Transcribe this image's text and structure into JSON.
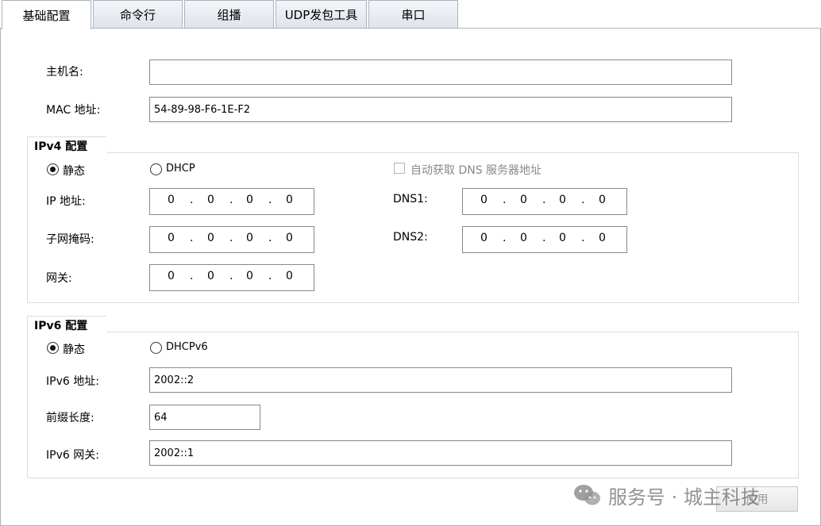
{
  "tabs": [
    {
      "label": "基础配置",
      "active": true
    },
    {
      "label": "命令行",
      "active": false
    },
    {
      "label": "组播",
      "active": false
    },
    {
      "label": "UDP发包工具",
      "active": false
    },
    {
      "label": "串口",
      "active": false
    }
  ],
  "basic": {
    "hostname_label": "主机名:",
    "hostname_value": "",
    "mac_label": "MAC 地址:",
    "mac_value": "54-89-98-F6-1E-F2"
  },
  "ipv4": {
    "legend": "IPv4 配置",
    "static_label": "静态",
    "dhcp_label": "DHCP",
    "mode": "static",
    "auto_dns_label": "自动获取 DNS 服务器地址",
    "ip_label": "IP 地址:",
    "ip": [
      "0",
      "0",
      "0",
      "0"
    ],
    "mask_label": "子网掩码:",
    "mask": [
      "0",
      "0",
      "0",
      "0"
    ],
    "gateway_label": "网关:",
    "gateway": [
      "0",
      "0",
      "0",
      "0"
    ],
    "dns1_label": "DNS1:",
    "dns1": [
      "0",
      "0",
      "0",
      "0"
    ],
    "dns2_label": "DNS2:",
    "dns2": [
      "0",
      "0",
      "0",
      "0"
    ]
  },
  "ipv6": {
    "legend": "IPv6 配置",
    "static_label": "静态",
    "dhcp_label": "DHCPv6",
    "mode": "static",
    "addr_label": "IPv6 地址:",
    "addr_value": "2002::2",
    "prefix_label": "前缀长度:",
    "prefix_value": "64",
    "gateway_label": "IPv6 网关:",
    "gateway_value": "2002::1"
  },
  "apply_label": "应用",
  "watermark": "服务号 · 城主科技"
}
